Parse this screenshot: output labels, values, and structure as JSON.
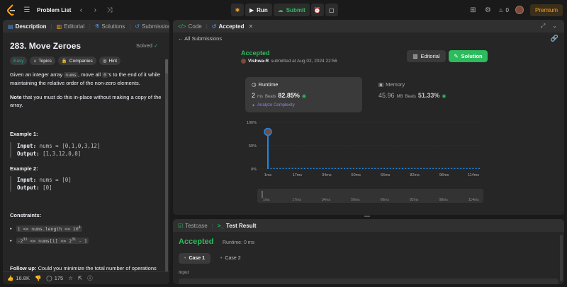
{
  "topbar": {
    "title": "Problem List",
    "run_label": "Run",
    "submit_label": "Submit",
    "streak_count": "0",
    "premium_label": "Premium"
  },
  "left": {
    "tabs": [
      "Description",
      "Editorial",
      "Solutions",
      "Submissions"
    ],
    "title": "283. Move Zeroes",
    "solved_label": "Solved",
    "chips": [
      "Easy",
      "Topics",
      "Companies",
      "Hint"
    ],
    "desc_1a": "Given an integer array ",
    "desc_1_code": "nums",
    "desc_1b": ", move all ",
    "desc_1_code2": "0",
    "desc_1c": "'s to the end of it while maintaining the relative order of the non-zero elements.",
    "note_bold": "Note",
    "note_rest": " that you must do this in-place without making a copy of the array.",
    "example1_title": "Example 1:",
    "example1_input_label": "Input:",
    "example1_input": "nums = [0,1,0,3,12]",
    "example1_output_label": "Output:",
    "example1_output": "[1,3,12,0,0]",
    "example2_title": "Example 2:",
    "example2_input_label": "Input:",
    "example2_input": "nums = [0]",
    "example2_output_label": "Output:",
    "example2_output": "[0]",
    "constraints_title": "Constraints:",
    "constraint1": "1 <= nums.length <= 10",
    "constraint1_sup": "4",
    "constraint2_a": "-2",
    "constraint2_sup1": "31",
    "constraint2_b": " <= nums[i] <= 2",
    "constraint2_sup2": "31",
    "constraint2_c": " - 1",
    "followup_bold": "Follow up:",
    "followup_rest": " Could you minimize the total number of operations",
    "likes": "16.8K",
    "comments": "175"
  },
  "right_top": {
    "tabs": [
      "Code",
      "Accepted"
    ],
    "all_submissions": "All Submissions",
    "status": "Accepted",
    "user": "Vishwa-R",
    "submitted_text": "submitted at Aug 02, 2024 22:56",
    "editorial_label": "Editorial",
    "solution_label": "Solution",
    "runtime_label": "Runtime",
    "runtime_value": "2",
    "runtime_unit": "ms",
    "runtime_beats_label": "Beats",
    "runtime_beats": "82.85%",
    "analyze_label": "Analyze Complexity",
    "memory_label": "Memory",
    "memory_value": "45.96",
    "memory_unit": "MB",
    "memory_beats_label": "Beats",
    "memory_beats": "51.33%"
  },
  "chart_data": {
    "type": "bar",
    "x_tick_labels": [
      "1ms",
      "17ms",
      "34ms",
      "50ms",
      "66ms",
      "82ms",
      "98ms",
      "114ms"
    ],
    "y_tick_labels": [
      "100%",
      "50%",
      "0%"
    ],
    "ylim": [
      0,
      100
    ],
    "highlight_x": "1ms",
    "highlight_value": 75,
    "baseline_value": 2,
    "num_bars": 70,
    "colors": {
      "bar": "#1e88e5",
      "grid": "#3e3e3e"
    },
    "range_tick_labels": [
      "1ms",
      "17ms",
      "34ms",
      "50ms",
      "66ms",
      "82ms",
      "98ms",
      "114ms"
    ]
  },
  "right_bottom": {
    "tabs": [
      "Testcase",
      "Test Result"
    ],
    "status": "Accepted",
    "runtime_text": "Runtime: 0 ms",
    "cases": [
      "Case 1",
      "Case 2"
    ],
    "input_label": "Input"
  }
}
